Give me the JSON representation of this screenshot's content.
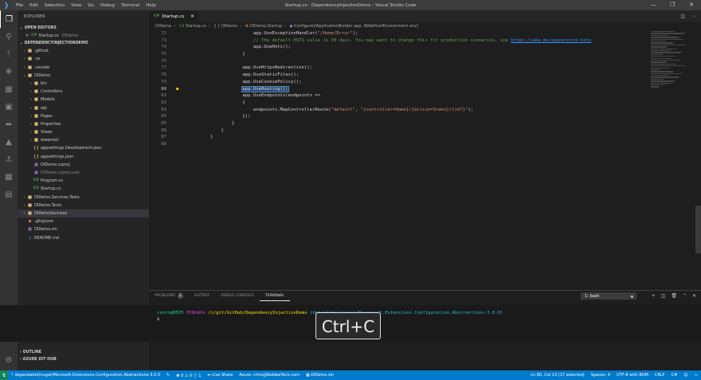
{
  "window": {
    "title": "Startup.cs - DependencyInjectionDemo - Visual Studio Code",
    "menu": [
      "File",
      "Edit",
      "Selection",
      "View",
      "Go",
      "Debug",
      "Terminal",
      "Help"
    ]
  },
  "sidebar": {
    "header": "EXPLORER",
    "open_editors_label": "OPEN EDITORS",
    "open_editor": {
      "name": "Startup.cs",
      "folder": "DIDemo"
    },
    "project_label": "DEPENDENCYINJECTIONDEMO",
    "tree": [
      {
        "name": ".github",
        "kind": "folder",
        "indent": 0,
        "open": false
      },
      {
        "name": ".vs",
        "kind": "folder",
        "indent": 0,
        "open": false
      },
      {
        "name": ".vscode",
        "kind": "folder",
        "indent": 0,
        "open": false
      },
      {
        "name": "DIDemo",
        "kind": "folder",
        "indent": 0,
        "open": true
      },
      {
        "name": "bin",
        "kind": "folder",
        "indent": 1,
        "open": false
      },
      {
        "name": "Controllers",
        "kind": "folder",
        "indent": 1,
        "open": false
      },
      {
        "name": "Models",
        "kind": "folder",
        "indent": 1,
        "open": false
      },
      {
        "name": "obj",
        "kind": "folder",
        "indent": 1,
        "open": false
      },
      {
        "name": "Pages",
        "kind": "folder",
        "indent": 1,
        "open": false
      },
      {
        "name": "Properties",
        "kind": "folder",
        "indent": 1,
        "open": false
      },
      {
        "name": "Views",
        "kind": "folder",
        "indent": 1,
        "open": false
      },
      {
        "name": "wwwroot",
        "kind": "folder",
        "indent": 1,
        "open": false
      },
      {
        "name": "appsettings.Development.json",
        "kind": "json",
        "indent": 1
      },
      {
        "name": "appsettings.json",
        "kind": "json",
        "indent": 1
      },
      {
        "name": "DIDemo.csproj",
        "kind": "proj",
        "indent": 1
      },
      {
        "name": "DIDemo.csproj.user",
        "kind": "proj-dim",
        "indent": 1
      },
      {
        "name": "Program.cs",
        "kind": "cs",
        "indent": 1
      },
      {
        "name": "Startup.cs",
        "kind": "cs",
        "indent": 1
      },
      {
        "name": "DIDemo.Services.Tests",
        "kind": "folder",
        "indent": 0,
        "open": false
      },
      {
        "name": "DIDemo.Tests",
        "kind": "folder",
        "indent": 0,
        "open": false
      },
      {
        "name": "DIDemoServices",
        "kind": "folder",
        "indent": 0,
        "open": false,
        "selected": true
      },
      {
        "name": ".gitignore",
        "kind": "git",
        "indent": 0
      },
      {
        "name": "DIDemo.sln",
        "kind": "proj",
        "indent": 0
      },
      {
        "name": "README.md",
        "kind": "md",
        "indent": 0
      }
    ],
    "outline_label": "OUTLINE",
    "azure_label": "AZURE IOT HUB"
  },
  "editor": {
    "tab": {
      "icon": "C#",
      "label": "Startup.cs"
    },
    "breadcrumb": [
      "DIDemo",
      "Startup.cs",
      "{ } DIDemo",
      "DIDemo.Startup",
      "Configure(IApplicationBuilder app, IWebHostEnvironment env)"
    ],
    "cursor_line": "80",
    "lines": [
      {
        "n": "72",
        "parts": [
          {
            "t": "                app.UseExceptionHandler("
          },
          {
            "t": "\"/Home/Error\"",
            "c": "str"
          },
          {
            "t": ");"
          }
        ]
      },
      {
        "n": "73",
        "parts": [
          {
            "t": "                // The default HSTS value is 30 days. You may want to change this for production scenarios, see ",
            "c": "cmt"
          },
          {
            "t": "https://aka.ms/aspnetcore-hsts",
            "c": "lnk"
          },
          {
            "t": ".",
            "c": "cmt"
          }
        ]
      },
      {
        "n": "74",
        "parts": [
          {
            "t": "                app.UseHsts();"
          }
        ]
      },
      {
        "n": "75",
        "parts": [
          {
            "t": "            }"
          }
        ]
      },
      {
        "n": "76",
        "parts": [
          {
            "t": ""
          }
        ]
      },
      {
        "n": "77",
        "parts": [
          {
            "t": "            app.UseHttpsRedirection();"
          }
        ]
      },
      {
        "n": "78",
        "parts": [
          {
            "t": "            app.UseStaticFiles();"
          }
        ]
      },
      {
        "n": "79",
        "parts": [
          {
            "t": "            app.UseCookiePolicy();"
          }
        ]
      },
      {
        "n": "80",
        "parts": [
          {
            "t": "            "
          },
          {
            "t": "app.UseRouting();",
            "c": "hl"
          }
        ]
      },
      {
        "n": "81",
        "parts": [
          {
            "t": "            app.UseEndpoints(endpoints =>"
          }
        ]
      },
      {
        "n": "82",
        "parts": [
          {
            "t": "            {"
          }
        ]
      },
      {
        "n": "83",
        "parts": [
          {
            "t": "                endpoints.MapControllerRoute("
          },
          {
            "t": "\"default\"",
            "c": "str"
          },
          {
            "t": ", "
          },
          {
            "t": "\"{controller=Home}/{action=Index}/{id?}\"",
            "c": "str"
          },
          {
            "t": ");"
          }
        ]
      },
      {
        "n": "84",
        "parts": [
          {
            "t": "            });"
          }
        ]
      },
      {
        "n": "85",
        "parts": [
          {
            "t": "        }"
          }
        ]
      },
      {
        "n": "86",
        "parts": [
          {
            "t": "    }"
          }
        ]
      },
      {
        "n": "87",
        "parts": [
          {
            "t": "}"
          }
        ]
      },
      {
        "n": "88",
        "parts": [
          {
            "t": ""
          }
        ]
      }
    ]
  },
  "panel": {
    "tabs": [
      "PROBLEMS",
      "OUTPUT",
      "DEBUG CONSOLE",
      "TERMINAL"
    ],
    "problems_count": "1",
    "active_tab": "TERMINAL",
    "terminal_select": "1: bash"
  },
  "terminal": {
    "user": "csoto@R5P5",
    "host": "MINGW64",
    "path": "/c/git/GitHub/DependencyInjectionDemo",
    "branch": "(dependabot/nuget/Microsoft.Extensions.Configuration.Abstractions-3.0.0)",
    "prompt": "$"
  },
  "keystroke_overlay": "Ctrl+C",
  "status": {
    "branch": "dependabot/nuget/Microsoft.Extensions.Configuration.Abstractions-3.0.0",
    "errors": "0",
    "warnings": "0",
    "info": "1",
    "live_share": "Live Share",
    "azure": "Azure: chris@NebbiaTech.com",
    "solution": "DIDemo.sln",
    "position": "Ln 80, Col 13 (17 selected)",
    "spaces": "Spaces: 4",
    "encoding": "UTF-8 with BOM",
    "eol": "CRLF",
    "language": "C#"
  },
  "colors": {
    "accent": "#007acc",
    "selection": "#264f78"
  }
}
